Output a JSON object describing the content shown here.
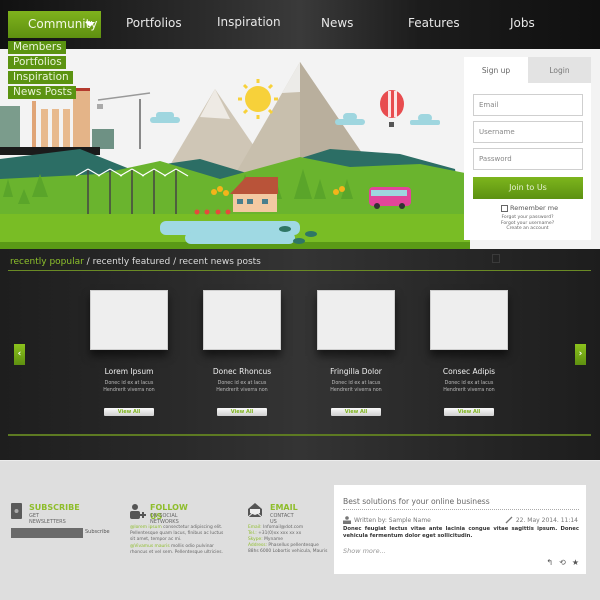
{
  "nav": {
    "community_label": "Community",
    "items": [
      "Portfolios",
      "Inspiration",
      "News",
      "Features",
      "Jobs"
    ],
    "dropdown": [
      "Members",
      "Portfolios",
      "Inspiration",
      "News Posts"
    ]
  },
  "login": {
    "tab_signup": "Sign up",
    "tab_login": "Login",
    "email_placeholder": "Email",
    "username_placeholder": "Username",
    "password_placeholder": "Password",
    "join_label": "Join to Us",
    "remember_label": "Remember me",
    "forgot_password": "Forgot your password?",
    "forgot_username": "Forgot your username?",
    "create_account": "Create an account"
  },
  "content": {
    "tab_active": "recently popular",
    "tab_rest": " / recently featured / recent news posts",
    "prev_icon": "‹",
    "next_icon": "›",
    "cards": [
      {
        "title": "Lorem Ipsum",
        "line1": "Donec id ex at lacus",
        "line2": "Hendrerit viverra non",
        "button": "View All"
      },
      {
        "title": "Donec Rhoncus",
        "line1": "Donec id ex at lacus",
        "line2": "Hendrerit viverra non",
        "button": "View All"
      },
      {
        "title": "Fringilla Dolor",
        "line1": "Donec id ex at lacus",
        "line2": "Hendrerit viverra non",
        "button": "View All"
      },
      {
        "title": "Consec Adipis",
        "line1": "Donec id ex at lacus",
        "line2": "Hendrerit viverra non",
        "button": "View All"
      }
    ]
  },
  "footer": {
    "subscribe": {
      "heading": "SUBSCRIBE",
      "sub": "GET NEWSLETTERS",
      "button": "Subscribe"
    },
    "follow": {
      "heading": "FOLLOW US",
      "sub": "ON SOCIAL NETWORKS",
      "p1_lead": "@lorem ipsum",
      "p1": " consectetur adipiscing elit. Pellentesque quam lacus, finibus ac luctus sit amet, tempor ac mi.",
      "p2_lead": "@Vivamus mauris",
      "p2": " mollis odio pulvinar rhoncus et vel sem. Pellentesque ultricies."
    },
    "email": {
      "heading": "EMAIL",
      "sub": "CONTACT US",
      "email_label": "Email:",
      "email_value": " Infomail@dot.com",
      "tel_label": "Tel.:",
      "tel_value": " +31(0)xx xxx xx xx",
      "skype_label": "Skype:",
      "skype_value": " Myname",
      "address_label": "Address:",
      "address_value": " Phasellus pellentesque 88hs 6000 Lobortis vehicula, Mauris"
    }
  },
  "post": {
    "title": "Best solutions for your online business",
    "author": "Written by: Sample Name",
    "date": "22. May 2014.  11:14",
    "body": "Donec feugiat lectus vitae ante lacinia congue vitae sagittis ipsum. Donec vehicula fermentum dolor eget sollicitudin.",
    "more": "Show more...",
    "actions": [
      "↰",
      "⟲",
      "★"
    ]
  },
  "colors": {
    "accent": "#7db31d",
    "dark": "#2a2a2a",
    "footer_bg": "#dedede"
  }
}
